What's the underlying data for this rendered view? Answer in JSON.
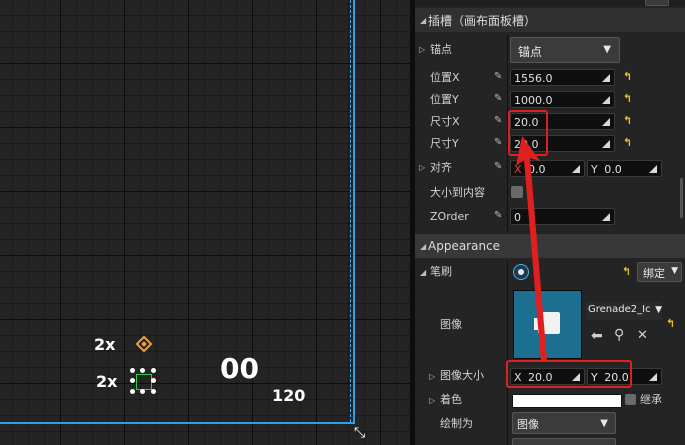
{
  "viewport": {
    "texts": {
      "t1": "2x",
      "t2": "2x",
      "t3": "00",
      "t4": "120"
    }
  },
  "details": {
    "slot_header": "插槽（画布面板槽）",
    "anchor": {
      "label": "锚点",
      "value": "锚点"
    },
    "pos_x": {
      "label": "位置X",
      "value": "1556.0"
    },
    "pos_y": {
      "label": "位置Y",
      "value": "1000.0"
    },
    "size_x": {
      "label": "尺寸X",
      "value": "20.0"
    },
    "size_y": {
      "label": "尺寸Y",
      "value": "20.0"
    },
    "align": {
      "label": "对齐",
      "x_prefix": "X",
      "x_value": "0.0",
      "y_prefix": "Y",
      "y_value": "0.0"
    },
    "size_to_content": {
      "label": "大小到内容"
    },
    "zorder": {
      "label": "ZOrder",
      "value": "0"
    },
    "appearance_header": "Appearance",
    "brush": {
      "label": "笔刷",
      "bind_label": "绑定"
    },
    "image": {
      "label": "图像",
      "asset_name": "Grenade2_Ic"
    },
    "image_size": {
      "label": "图像大小",
      "x_prefix": "X",
      "x_value": "20.0",
      "y_prefix": "Y",
      "y_value": "20.0"
    },
    "tint": {
      "label": "着色",
      "inherit_label": "继承"
    },
    "draw_as": {
      "label": "绘制为",
      "value": "图像"
    }
  },
  "colors": {
    "canvas_border": "#29a0e8",
    "highlight": "#e02020",
    "reset_arrow": "#e0c030",
    "thumbnail_bg": "#1c6f8e"
  }
}
